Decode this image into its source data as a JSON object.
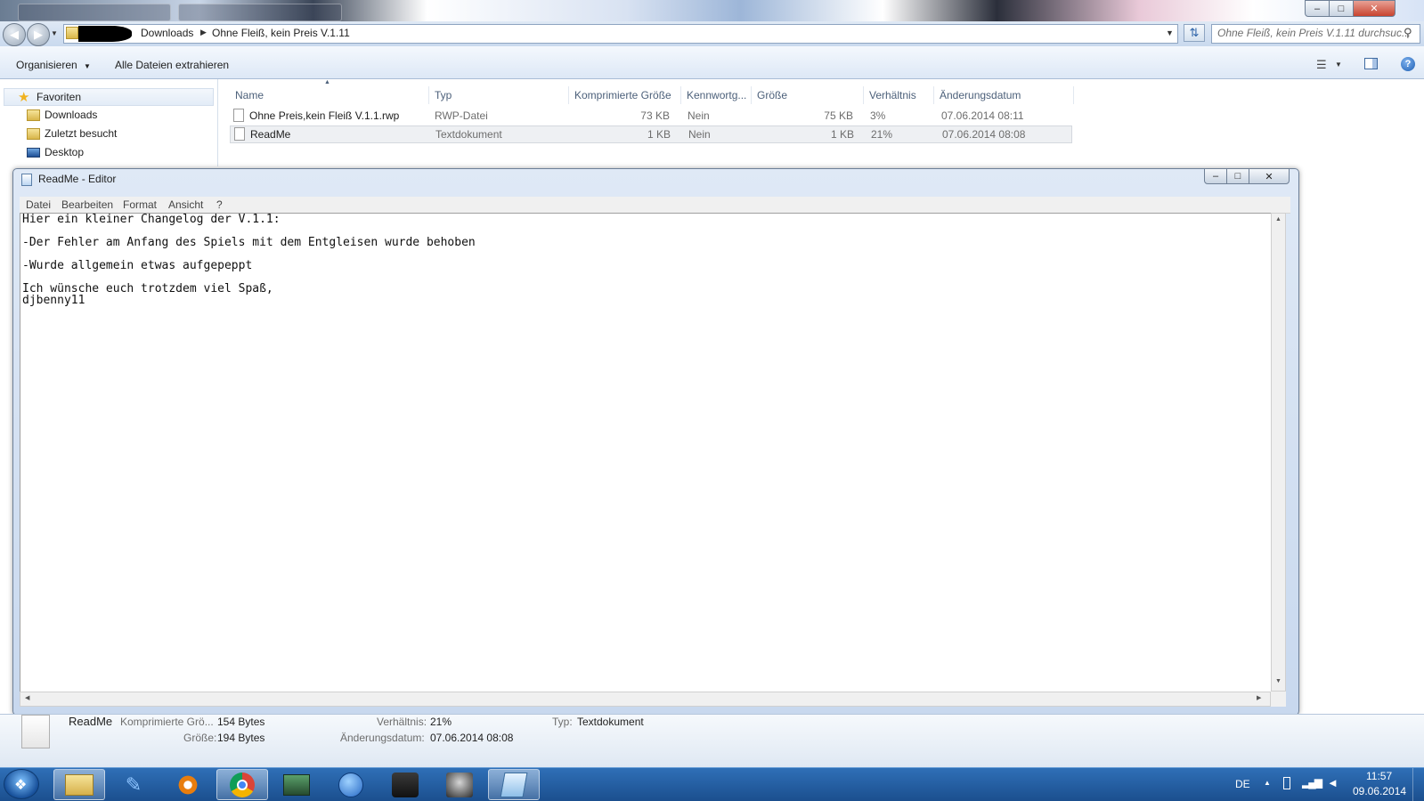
{
  "window": {
    "minimize_glyph": "–",
    "maximize_glyph": "□",
    "close_glyph": "✕"
  },
  "explorer": {
    "breadcrumb": [
      "Downloads",
      "Ohne Fleiß, kein Preis V.1.11"
    ],
    "search_placeholder": "Ohne Fleiß, kein Preis V.1.11 durchsuc...",
    "toolbar": {
      "organize_label": "Organisieren",
      "extract_label": "Alle Dateien extrahieren"
    },
    "sidebar": {
      "favorites_label": "Favoriten",
      "items": [
        {
          "label": "Downloads",
          "icon": "folder-icon"
        },
        {
          "label": "Zuletzt besucht",
          "icon": "recent-places-icon"
        },
        {
          "label": "Desktop",
          "icon": "desktop-icon"
        }
      ]
    },
    "columns": [
      "Name",
      "Typ",
      "Komprimierte Größe",
      "Kennwortg...",
      "Größe",
      "Verhältnis",
      "Änderungsdatum"
    ],
    "files": [
      {
        "name": "Ohne Preis,kein Fleiß V.1.1.rwp",
        "type": "RWP-Datei",
        "compressed": "73 KB",
        "password": "Nein",
        "size": "75 KB",
        "ratio": "3%",
        "date": "07.06.2014 08:11"
      },
      {
        "name": "ReadMe",
        "type": "Textdokument",
        "compressed": "1 KB",
        "password": "Nein",
        "size": "1 KB",
        "ratio": "21%",
        "date": "07.06.2014 08:08"
      }
    ]
  },
  "notepad": {
    "title": "ReadMe - Editor",
    "menu": [
      "Datei",
      "Bearbeiten",
      "Format",
      "Ansicht",
      "?"
    ],
    "lines": [
      "Hier ein kleiner Changelog der V.1.1:",
      "-Der Fehler am Anfang des Spiels mit dem Entgleisen wurde behoben",
      "-Wurde allgemein etwas aufgepeppt",
      "Ich wünsche euch trotzdem viel Spaß,",
      "djbenny11"
    ]
  },
  "details": {
    "filename": "ReadMe",
    "compressed_label": "Komprimierte Grö...",
    "compressed_value": "154 Bytes",
    "size_label": "Größe:",
    "size_value": "194 Bytes",
    "ratio_label": "Verhältnis:",
    "ratio_value": "21%",
    "date_label": "Änderungsdatum:",
    "date_value": "07.06.2014 08:08",
    "type_label": "Typ:",
    "type_value": "Textdokument"
  },
  "taskbar": {
    "apps": [
      "explorer-icon",
      "paint-icon",
      "blender-icon",
      "chrome-icon",
      "media-icon",
      "globe-icon",
      "steam-icon",
      "game-icon",
      "notepad-icon"
    ],
    "language": "DE",
    "time": "11:57",
    "date": "09.06.2014"
  },
  "colors": {
    "taskbar": "#1b4f8e",
    "selection": "#eef0f3",
    "header_text": "#4c607a"
  }
}
